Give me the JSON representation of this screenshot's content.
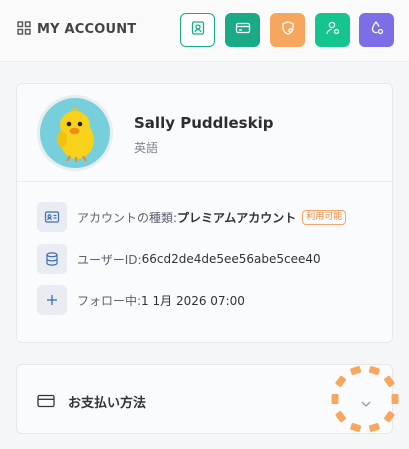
{
  "header": {
    "title": "MY ACCOUNT",
    "buttons": [
      {
        "name": "profile-button",
        "icon": "id-badge-icon",
        "bg": "#ffffff",
        "fg": "#1aaa86",
        "border": "#1aaa86"
      },
      {
        "name": "card-button",
        "icon": "credit-card-icon",
        "bg": "#1aaa86",
        "fg": "#ffffff"
      },
      {
        "name": "shield-button",
        "icon": "shield-icon",
        "bg": "#f6a75d",
        "fg": "#ffffff"
      },
      {
        "name": "user-settings-button",
        "icon": "user-gear-icon",
        "bg": "#16c48e",
        "fg": "#ffffff"
      },
      {
        "name": "drop-settings-button",
        "icon": "drop-gear-icon",
        "bg": "#7b6ee6",
        "fg": "#ffffff"
      }
    ]
  },
  "profile": {
    "name": "Sally Puddleskip",
    "language": "英語"
  },
  "account": {
    "type_label": "アカウントの種類: ",
    "type_value": "プレミアムアカウント",
    "type_badge": "利用可能",
    "user_id_label": "ユーザーID: ",
    "user_id_value": "66cd2de4de5ee56abe5cee40",
    "follow_label": "フォロー中: ",
    "follow_value": "1 1月 2026 07:00"
  },
  "payment": {
    "title": "お支払い方法"
  },
  "colors": {
    "accent_green": "#1aaa86",
    "accent_orange": "#f6a75d",
    "spinner": "#f6a75d"
  }
}
